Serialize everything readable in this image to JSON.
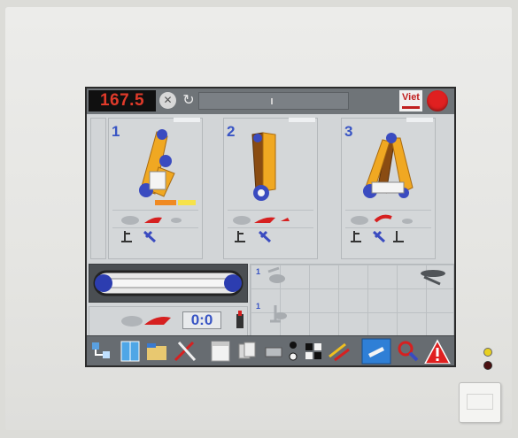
{
  "hmi": {
    "counter": "167.5",
    "logo_text": "Viet",
    "station_1": "1",
    "station_2": "2",
    "station_3": "3",
    "conveyor_counter": "0:0",
    "grid_1": "1",
    "grid_2": "1"
  },
  "colors": {
    "accent_red": "#e02020",
    "label_blue": "#3854c4",
    "frame_yellow": "#f0a822"
  },
  "icons": {
    "x_button": "close-circle-icon",
    "refresh": "refresh-icon",
    "estop": "emergency-stop-icon",
    "warning": "warning-triangle-icon"
  }
}
